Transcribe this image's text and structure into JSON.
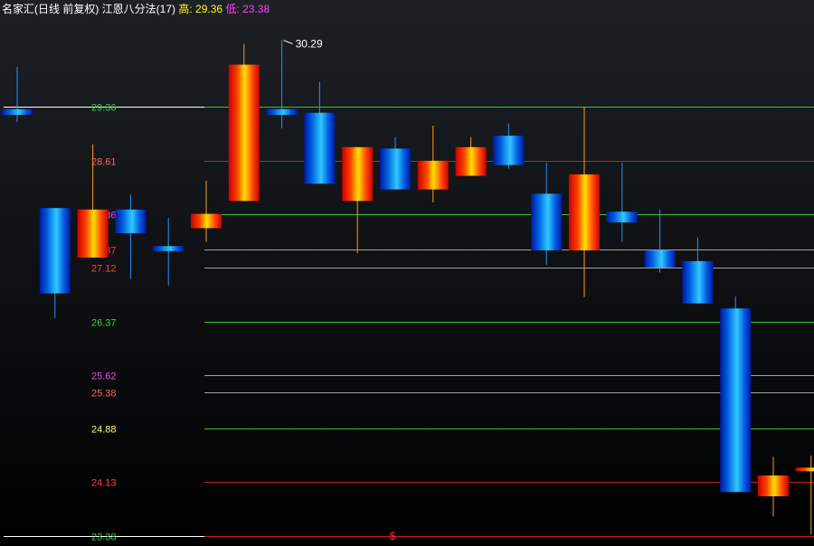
{
  "header": {
    "title": "名家汇(日线 前复权) 江恩八分法(17)",
    "high_label": "高:",
    "high_value": "29.36",
    "low_label": "低:",
    "low_value": "23.38"
  },
  "chart_data": {
    "type": "candlestick",
    "ylim": [
      23.3,
      30.6
    ],
    "levels": [
      {
        "label": "29.36",
        "value": 29.36,
        "label_color": "#3cd23c",
        "line_color": "#30c830",
        "left_color": "#ffffff"
      },
      {
        "label": "28.61",
        "value": 28.61,
        "label_color": "#ff6060",
        "line_color": "#c81e1e"
      },
      {
        "label": "27.86",
        "value": 27.86,
        "label_color": "#ff40ff",
        "line_color": "#30c830"
      },
      {
        "label": "27.37",
        "value": 27.37,
        "label_color": "#ff4040",
        "line_color": "#a0a0a0"
      },
      {
        "label": "27.12",
        "value": 27.12,
        "label_color": "#ff4040",
        "line_color": "#a0a0a0"
      },
      {
        "label": "26.37",
        "value": 26.37,
        "label_color": "#3cd23c",
        "line_color": "#30c830"
      },
      {
        "label": "25.62",
        "value": 25.62,
        "label_color": "#ff40ff",
        "line_color": "#a0a0a0"
      },
      {
        "label": "25.38",
        "value": 25.38,
        "label_color": "#ff6060",
        "line_color": "#a0a0a0"
      },
      {
        "label": "24.88",
        "value": 24.88,
        "label_color": "#ffff40",
        "line_color": "#30c830"
      },
      {
        "label": "24.13",
        "value": 24.13,
        "label_color": "#ff4040",
        "line_color": "#c81e1e"
      },
      {
        "label": "23.38",
        "value": 23.38,
        "label_color": "#3cd23c",
        "line_color": "#c81e1e",
        "left_color": "#ffffff"
      }
    ],
    "annotations": [
      {
        "text": "30.29",
        "value": 30.29,
        "candle": 7
      }
    ],
    "bottom_marker": "$",
    "candles": [
      {
        "open": 29.25,
        "close": 29.33,
        "high": 29.92,
        "low": 29.15,
        "up": false
      },
      {
        "open": 27.95,
        "close": 26.76,
        "high": 27.95,
        "low": 26.42,
        "up": false
      },
      {
        "open": 27.26,
        "close": 27.93,
        "high": 28.84,
        "low": 27.26,
        "up": true
      },
      {
        "open": 27.93,
        "close": 27.6,
        "high": 28.14,
        "low": 26.96,
        "up": false
      },
      {
        "open": 27.42,
        "close": 27.35,
        "high": 27.81,
        "low": 26.87,
        "up": false
      },
      {
        "open": 27.67,
        "close": 27.87,
        "high": 28.33,
        "low": 27.48,
        "up": true
      },
      {
        "open": 28.05,
        "close": 29.95,
        "high": 30.24,
        "low": 28.05,
        "up": true
      },
      {
        "open": 29.25,
        "close": 29.33,
        "high": 30.29,
        "low": 29.06,
        "up": false
      },
      {
        "open": 29.28,
        "close": 28.29,
        "high": 29.71,
        "low": 28.29,
        "up": false
      },
      {
        "open": 28.05,
        "close": 28.8,
        "high": 28.8,
        "low": 27.32,
        "up": true
      },
      {
        "open": 28.78,
        "close": 28.21,
        "high": 28.94,
        "low": 28.21,
        "up": false
      },
      {
        "open": 28.21,
        "close": 28.61,
        "high": 29.1,
        "low": 28.03,
        "up": true
      },
      {
        "open": 28.4,
        "close": 28.8,
        "high": 28.94,
        "low": 28.4,
        "up": true
      },
      {
        "open": 28.96,
        "close": 28.55,
        "high": 29.13,
        "low": 28.5,
        "up": false
      },
      {
        "open": 28.15,
        "close": 27.36,
        "high": 28.58,
        "low": 27.16,
        "up": false
      },
      {
        "open": 27.36,
        "close": 28.42,
        "high": 29.36,
        "low": 26.71,
        "up": true
      },
      {
        "open": 27.9,
        "close": 27.75,
        "high": 28.58,
        "low": 27.48,
        "up": false
      },
      {
        "open": 27.36,
        "close": 27.12,
        "high": 27.93,
        "low": 27.05,
        "up": false
      },
      {
        "open": 27.21,
        "close": 26.62,
        "high": 27.54,
        "low": 26.62,
        "up": false
      },
      {
        "open": 26.55,
        "close": 23.99,
        "high": 26.72,
        "low": 23.99,
        "up": false
      },
      {
        "open": 23.93,
        "close": 24.22,
        "high": 24.48,
        "low": 23.65,
        "up": true
      },
      {
        "open": 24.3,
        "close": 24.33,
        "high": 24.5,
        "low": 23.4,
        "up": true
      }
    ]
  }
}
